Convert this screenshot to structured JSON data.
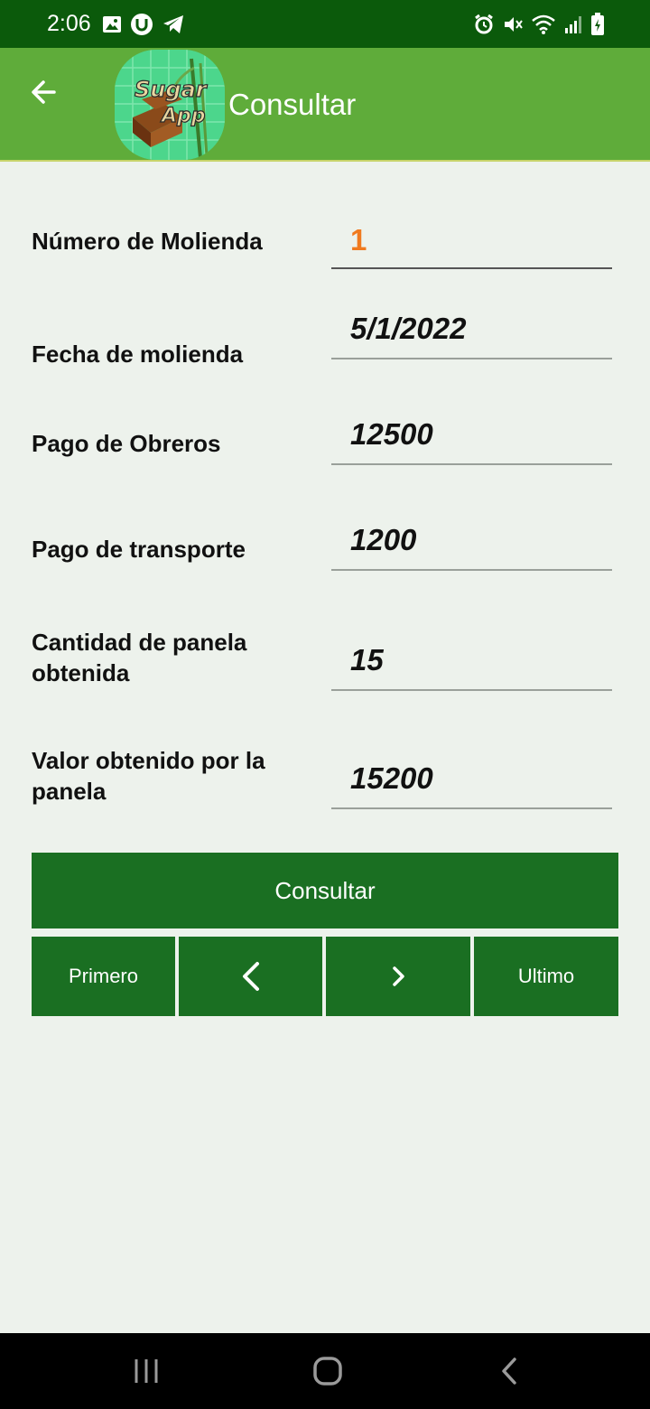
{
  "status_bar": {
    "time": "2:06"
  },
  "app_bar": {
    "title": "Consultar"
  },
  "form": {
    "fields": [
      {
        "label": "Número de Molienda",
        "value": "1"
      },
      {
        "label": "Fecha de molienda",
        "value": "5/1/2022"
      },
      {
        "label": "Pago de Obreros",
        "value": "12500"
      },
      {
        "label": "Pago de transporte",
        "value": "1200"
      },
      {
        "label": "Cantidad de panela obtenida",
        "value": "15"
      },
      {
        "label": "Valor obtenido por la panela",
        "value": "15200"
      }
    ]
  },
  "actions": {
    "consultar_label": "Consultar",
    "first_label": "Primero",
    "last_label": "Ultimo"
  },
  "colors": {
    "status_bar": "#0b5a0b",
    "app_bar": "#5fac3a",
    "button": "#1a6f22",
    "accent": "#f07a1f",
    "background": "#edf2ec"
  }
}
